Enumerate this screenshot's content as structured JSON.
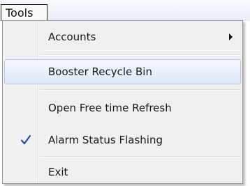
{
  "menubar": {
    "tools_label": "Tools"
  },
  "menu": {
    "items": [
      {
        "label": "Accounts",
        "has_submenu": true,
        "icon": "chevron-right-icon"
      },
      {
        "label": "Booster Recycle Bin",
        "highlighted": true
      },
      {
        "label": "Open Free time Refresh"
      },
      {
        "label": "Alarm Status Flashing",
        "checked": true,
        "icon": "checkmark-icon"
      },
      {
        "label": "Exit"
      }
    ]
  },
  "colors": {
    "highlight_border": "#b4cbe7",
    "highlight_fill": "#dce8f7",
    "check_color": "#1f4fb0"
  }
}
